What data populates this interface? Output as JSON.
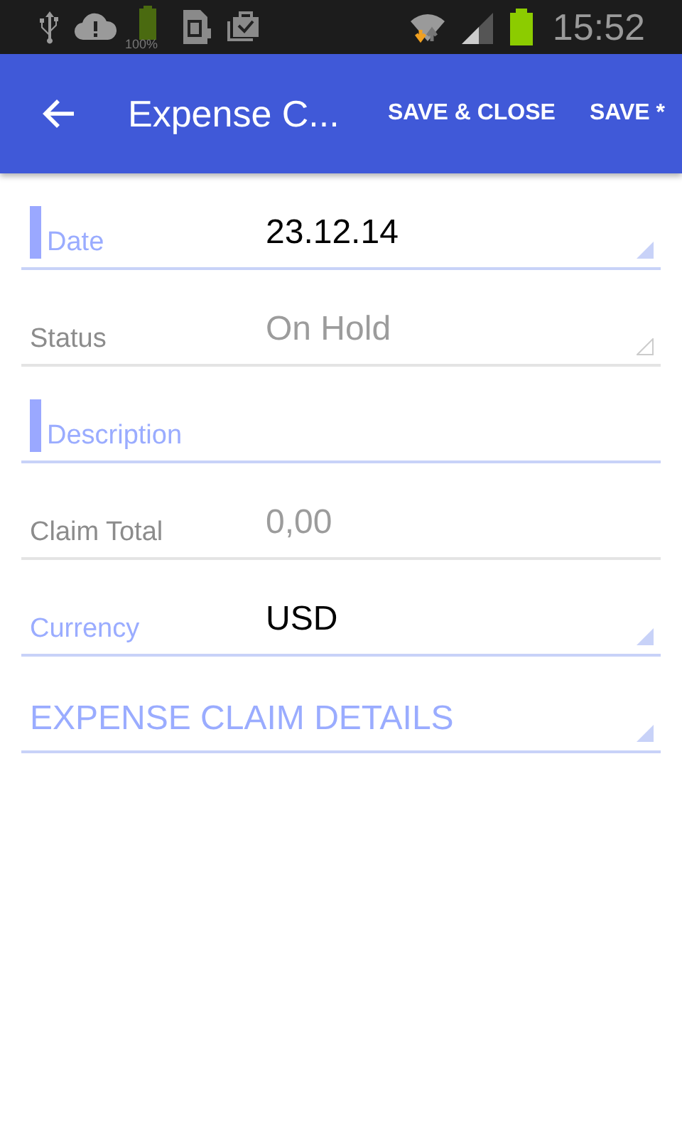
{
  "status_bar": {
    "battery_label": "100%",
    "time": "15:52"
  },
  "app_bar": {
    "title": "Expense C...",
    "actions": [
      "SAVE & CLOSE",
      "SAVE *"
    ]
  },
  "fields": [
    {
      "kind": "dropdown",
      "label": "Date",
      "value": "23.12.14",
      "mandatory": true,
      "disabled": false
    },
    {
      "kind": "dropdown",
      "label": "Status",
      "value": "On Hold",
      "mandatory": false,
      "disabled": true
    },
    {
      "kind": "text",
      "label": "Description",
      "mandatory": true,
      "disabled": false
    },
    {
      "kind": "text",
      "label": "Claim Total",
      "value": "0,00",
      "mandatory": false,
      "disabled": true
    },
    {
      "kind": "dropdown",
      "label": "Currency",
      "value": "USD",
      "mandatory": false,
      "disabled": false
    },
    {
      "kind": "section",
      "label": "EXPENSE CLAIM DETAILS"
    }
  ]
}
